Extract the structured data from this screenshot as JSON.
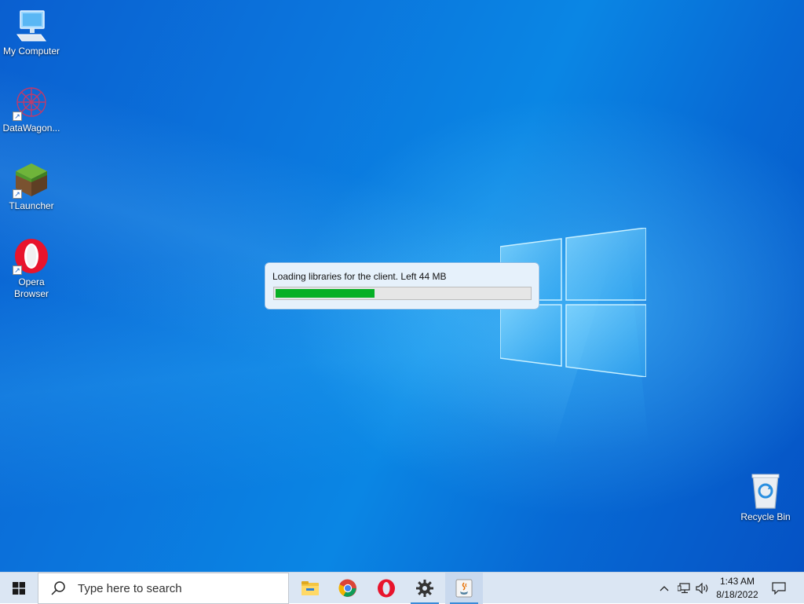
{
  "desktop": {
    "icons": [
      {
        "label": "My Computer",
        "icon": "computer-icon"
      },
      {
        "label": "DataWagon...",
        "icon": "datawagon-icon"
      },
      {
        "label": "TLauncher",
        "icon": "minecraft-grass-icon"
      },
      {
        "label": "Opera Browser",
        "icon": "opera-icon"
      },
      {
        "label": "Recycle Bin",
        "icon": "recycle-bin-icon"
      }
    ]
  },
  "loader": {
    "message": "Loading libraries for the client. Left 44 MB",
    "progress": 0.39,
    "progress_color": "#06b025"
  },
  "taskbar": {
    "search_placeholder": "Type here to search",
    "pinned": [
      "file-explorer-icon",
      "chrome-icon",
      "opera-icon",
      "settings-gear-icon",
      "java-icon"
    ],
    "clock": {
      "time": "1:43 AM",
      "date": "8/18/2022"
    }
  },
  "colors": {
    "desktop_blue": "#0a74dc",
    "taskbar_bg": "#dbe6f3",
    "accent": "#3a8bd8"
  }
}
